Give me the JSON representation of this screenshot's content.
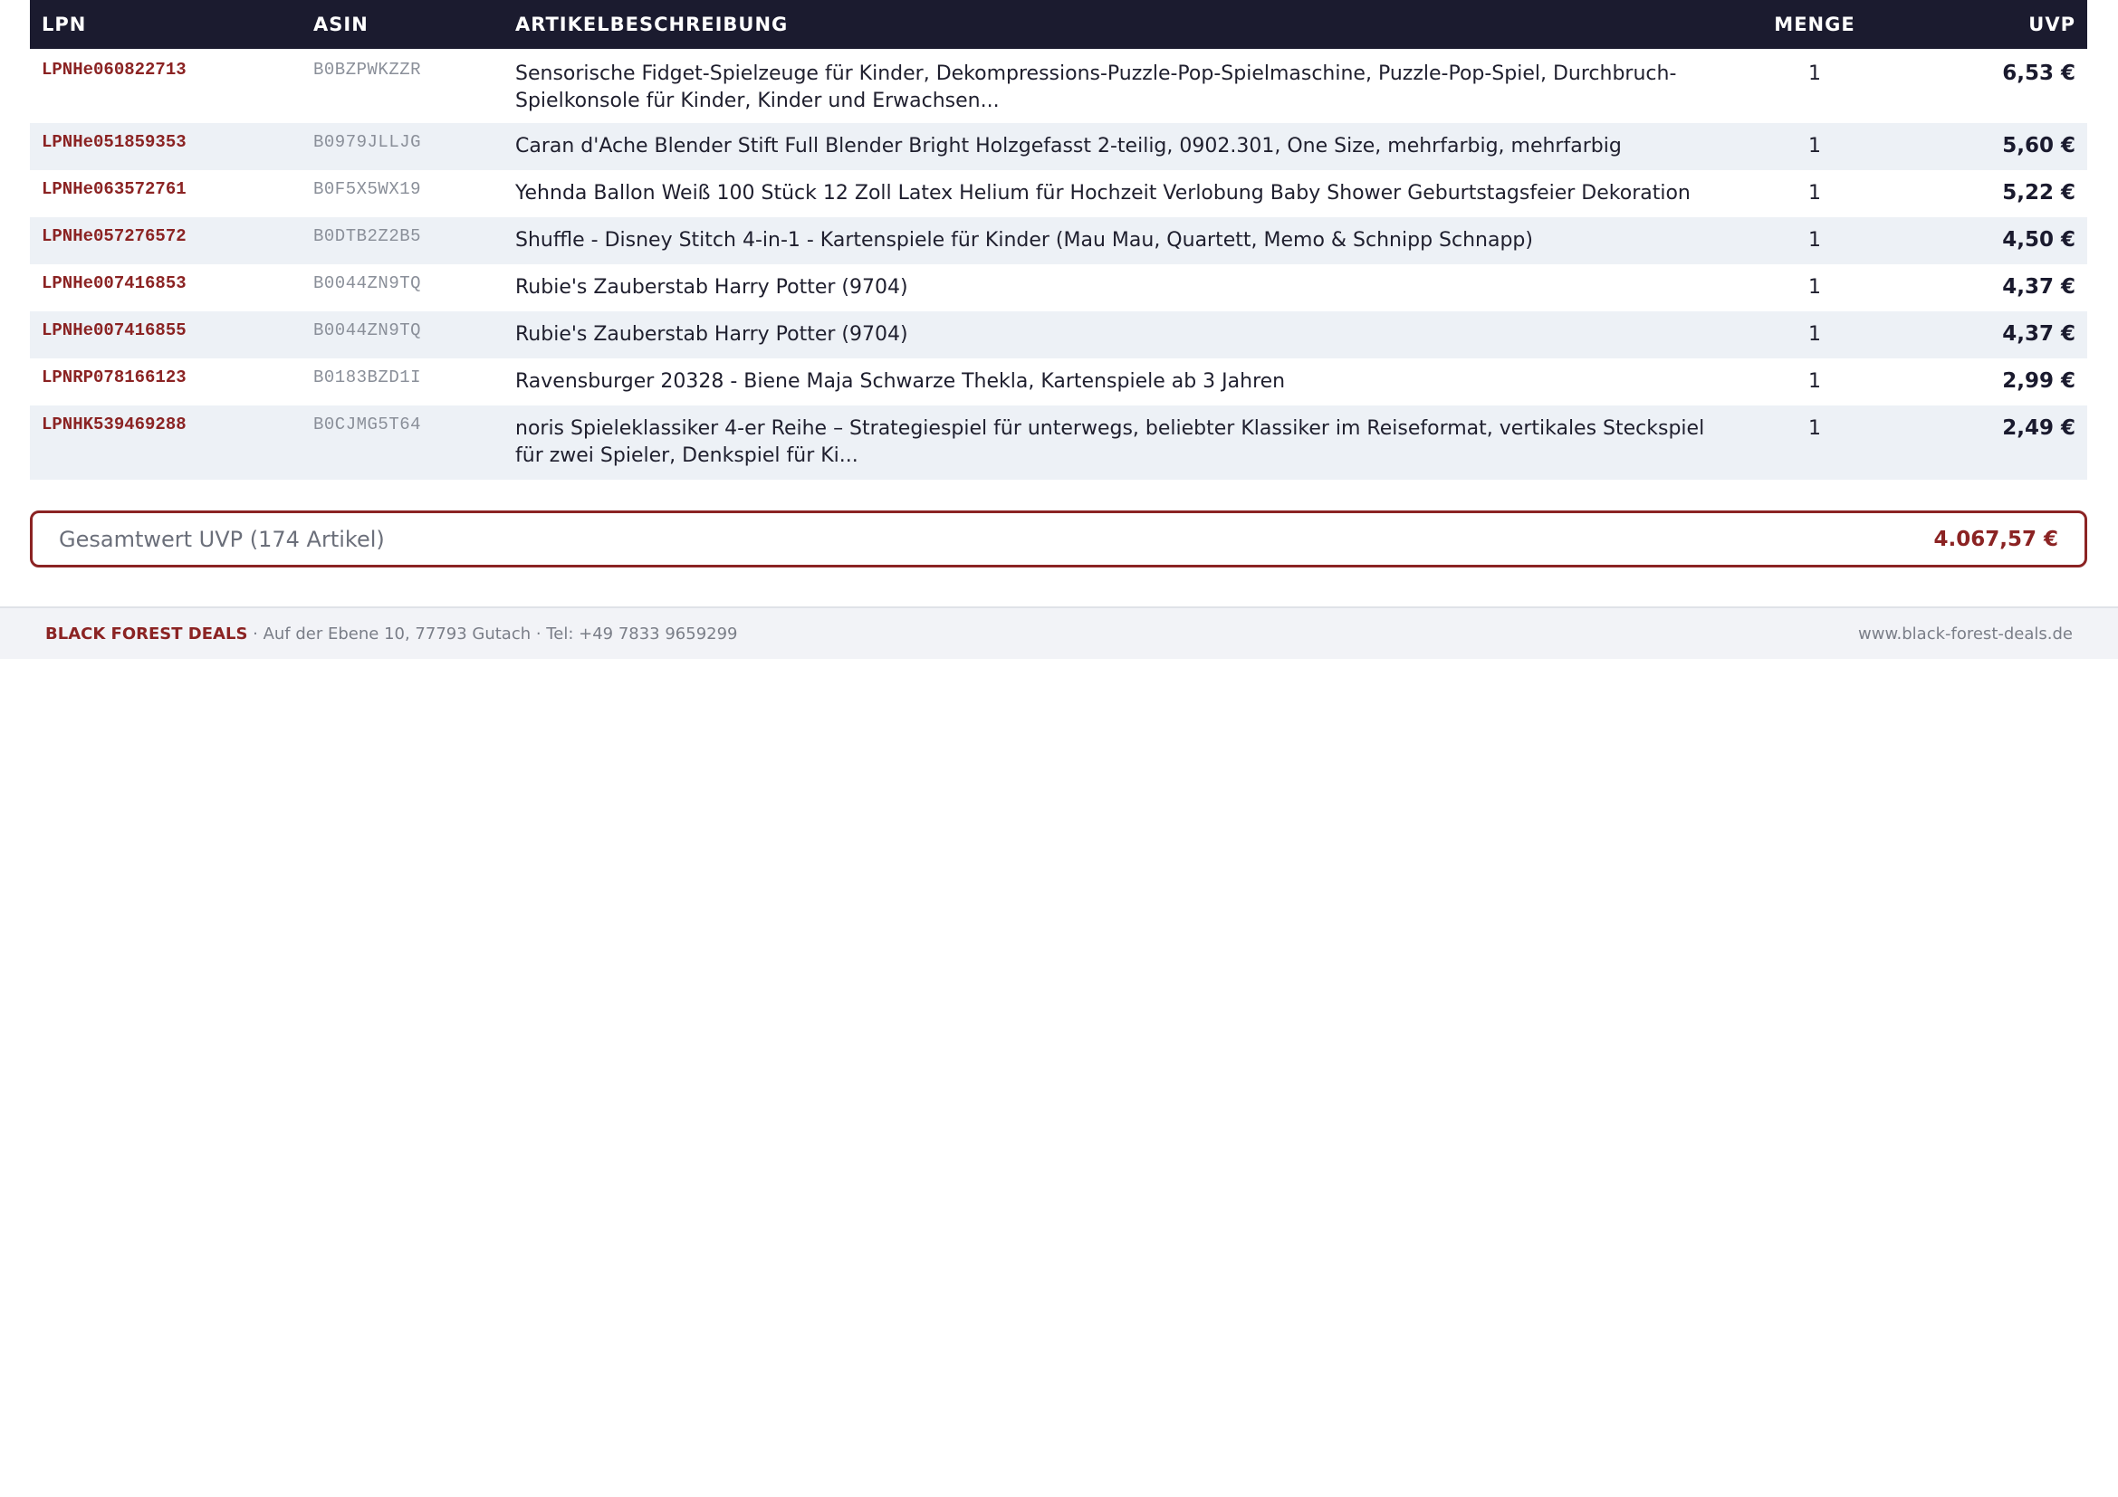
{
  "table": {
    "headers": {
      "lpn": "LPN",
      "asin": "ASIN",
      "description": "ARTIKELBESCHREIBUNG",
      "quantity": "MENGE",
      "uvp": "UVP"
    },
    "rows": [
      {
        "lpn": "LPNHe060822713",
        "asin": "B0BZPWKZZR",
        "description": "Sensorische Fidget-Spielzeuge für Kinder, Dekompressions-Puzzle-Pop-Spielmaschine, Puzzle-Pop-Spiel, Durchbruch-Spielkonsole für Kinder, Kinder und Erwachsen...",
        "quantity": "1",
        "uvp": "6,53 €"
      },
      {
        "lpn": "LPNHe051859353",
        "asin": "B0979JLLJG",
        "description": "Caran d'Ache Blender Stift Full Blender Bright Holzgefasst 2-teilig, 0902.301, One Size, mehrfarbig, mehrfarbig",
        "quantity": "1",
        "uvp": "5,60 €"
      },
      {
        "lpn": "LPNHe063572761",
        "asin": "B0F5X5WX19",
        "description": "Yehnda Ballon Weiß 100 Stück 12 Zoll Latex Helium für Hochzeit Verlobung Baby Shower Geburtstagsfeier Dekoration",
        "quantity": "1",
        "uvp": "5,22 €"
      },
      {
        "lpn": "LPNHe057276572",
        "asin": "B0DTB2Z2B5",
        "description": "Shuffle - Disney Stitch 4-in-1 - Kartenspiele für Kinder (Mau Mau, Quartett, Memo & Schnipp Schnapp)",
        "quantity": "1",
        "uvp": "4,50 €"
      },
      {
        "lpn": "LPNHe007416853",
        "asin": "B0044ZN9TQ",
        "description": "Rubie's Zauberstab Harry Potter (9704)",
        "quantity": "1",
        "uvp": "4,37 €"
      },
      {
        "lpn": "LPNHe007416855",
        "asin": "B0044ZN9TQ",
        "description": "Rubie's Zauberstab Harry Potter (9704)",
        "quantity": "1",
        "uvp": "4,37 €"
      },
      {
        "lpn": "LPNRP078166123",
        "asin": "B0183BZD1I",
        "description": "Ravensburger 20328 - Biene Maja Schwarze Thekla, Kartenspiele ab 3 Jahren",
        "quantity": "1",
        "uvp": "2,99 €"
      },
      {
        "lpn": "LPNHK539469288",
        "asin": "B0CJMG5T64",
        "description": "noris Spieleklassiker 4-er Reihe – Strategiespiel für unterwegs, beliebter Klassiker im Reiseformat, vertikales Steckspiel für zwei Spieler, Denkspiel für Ki...",
        "quantity": "1",
        "uvp": "2,49 €"
      }
    ]
  },
  "total": {
    "label": "Gesamtwert UVP (174 Artikel)",
    "value": "4.067,57 €"
  },
  "footer": {
    "brand": "BLACK FOREST DEALS",
    "address": " · Auf der Ebene 10, 77793 Gutach · Tel: +49 7833 9659299",
    "website": "www.black-forest-deals.de"
  },
  "colors": {
    "header_bg": "#1b1b2f",
    "accent": "#8b2323",
    "row_alt": "#edf1f6"
  }
}
